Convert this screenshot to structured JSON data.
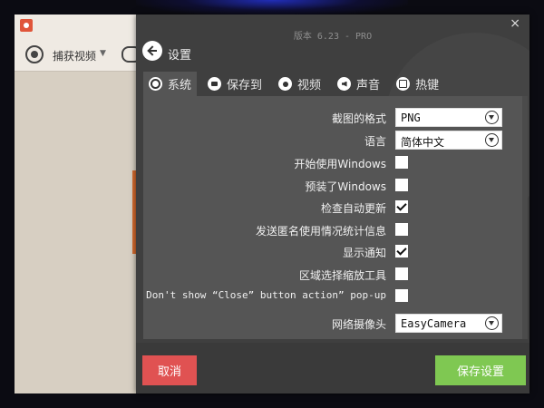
{
  "background_app": {
    "capture_label": "捕获视频"
  },
  "settings": {
    "version": "版本 6.23 - PRO",
    "title": "设置",
    "close_glyph": "×",
    "tabs": [
      {
        "label": "系统",
        "icon": "gear-icon",
        "active": true
      },
      {
        "label": "保存到",
        "icon": "folder-icon",
        "active": false
      },
      {
        "label": "视频",
        "icon": "record-icon",
        "active": false
      },
      {
        "label": "声音",
        "icon": "sound-icon",
        "active": false
      },
      {
        "label": "热键",
        "icon": "hotkey-icon",
        "active": false
      }
    ],
    "rows": [
      {
        "label": "截图的格式",
        "type": "select",
        "value": "PNG"
      },
      {
        "label": "语言",
        "type": "select",
        "value": "简体中文"
      },
      {
        "label": "开始使用Windows",
        "type": "checkbox",
        "checked": false
      },
      {
        "label": "预装了Windows",
        "type": "checkbox",
        "checked": false
      },
      {
        "label": "检查自动更新",
        "type": "checkbox",
        "checked": true
      },
      {
        "label": "发送匿名使用情况统计信息",
        "type": "checkbox",
        "checked": false
      },
      {
        "label": "显示通知",
        "type": "checkbox",
        "checked": true
      },
      {
        "label": "区域选择缩放工具",
        "type": "checkbox",
        "checked": false
      },
      {
        "label": "Don't show “Close” button action” pop-up",
        "type": "checkbox",
        "checked": false
      },
      {
        "label": "网络摄像头",
        "type": "select",
        "value": "EasyCamera"
      }
    ],
    "cancel_label": "取消",
    "save_label": "保存设置"
  },
  "colors": {
    "cancel": "#e05252",
    "save": "#7fc852",
    "panel": "#555555",
    "window": "#3f3f3f"
  }
}
